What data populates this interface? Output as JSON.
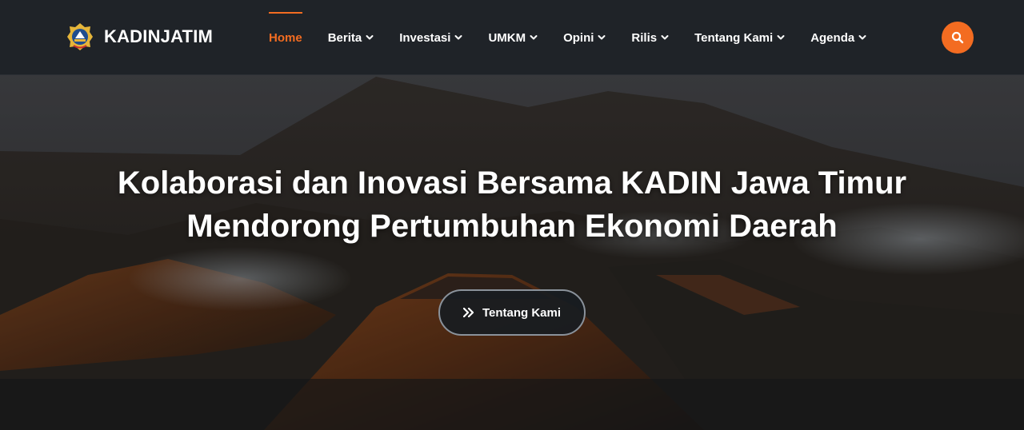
{
  "brand": {
    "name": "KADINJATIM",
    "logo_icon": "kadin-emblem-icon"
  },
  "nav": {
    "items": [
      {
        "label": "Home",
        "active": true,
        "has_dropdown": false
      },
      {
        "label": "Berita",
        "active": false,
        "has_dropdown": true
      },
      {
        "label": "Investasi",
        "active": false,
        "has_dropdown": true
      },
      {
        "label": "UMKM",
        "active": false,
        "has_dropdown": true
      },
      {
        "label": "Opini",
        "active": false,
        "has_dropdown": true
      },
      {
        "label": "Rilis",
        "active": false,
        "has_dropdown": true
      },
      {
        "label": "Tentang Kami",
        "active": false,
        "has_dropdown": true
      },
      {
        "label": "Agenda",
        "active": false,
        "has_dropdown": true
      }
    ],
    "search_icon": "search-icon"
  },
  "hero": {
    "title_line1": "Kolaborasi dan Inovasi Bersama KADIN Jawa Timur",
    "title_line2": "Mendorong Pertumbuhan Ekonomi Daerah",
    "button_label": "Tentang Kami",
    "button_icon": "double-chevron-right-icon"
  },
  "colors": {
    "accent": "#f36c21",
    "header_bg": "#1f2328",
    "text": "#ffffff"
  }
}
